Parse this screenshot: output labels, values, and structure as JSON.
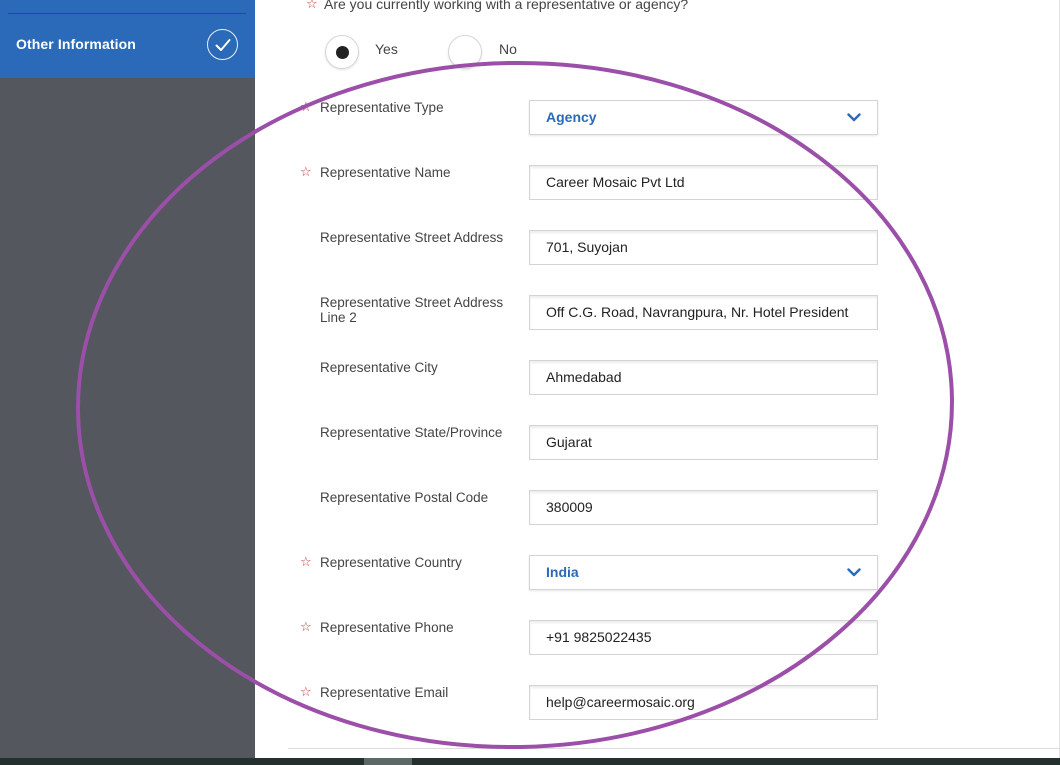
{
  "sidebar": {
    "active_item": {
      "label": "Other Information",
      "icon": "checkmark-icon"
    }
  },
  "question": {
    "text": "Are you currently working with a representative or agency?",
    "required_mark": "☆",
    "options": [
      {
        "label": "Yes",
        "selected": true
      },
      {
        "label": "No",
        "selected": false
      }
    ]
  },
  "fields": [
    {
      "label": "Representative Type",
      "value": "Agency",
      "required": true,
      "type": "select"
    },
    {
      "label": "Representative Name",
      "value": "Career Mosaic Pvt Ltd",
      "required": true,
      "type": "text"
    },
    {
      "label": "Representative Street Address",
      "value": "701, Suyojan",
      "required": false,
      "type": "text"
    },
    {
      "label": "Representative Street Address Line 2",
      "value": "Off C.G. Road, Navrangpura, Nr. Hotel President",
      "required": false,
      "type": "text"
    },
    {
      "label": "Representative City",
      "value": "Ahmedabad",
      "required": false,
      "type": "text"
    },
    {
      "label": "Representative State/Province",
      "value": "Gujarat",
      "required": false,
      "type": "text"
    },
    {
      "label": "Representative Postal Code",
      "value": "380009",
      "required": false,
      "type": "text"
    },
    {
      "label": "Representative Country",
      "value": "India",
      "required": true,
      "type": "select"
    },
    {
      "label": "Representative Phone",
      "value": "+91 9825022435",
      "required": true,
      "type": "text"
    },
    {
      "label": "Representative Email",
      "value": "help@careermosaic.org",
      "required": true,
      "type": "text"
    }
  ],
  "colors": {
    "sidebar_bg": "#54575d",
    "sidebar_active": "#2a6ab8",
    "required_star": "#c0392b",
    "select_text": "#2a6ab8",
    "annotation_circle": "#9b4fa8"
  }
}
